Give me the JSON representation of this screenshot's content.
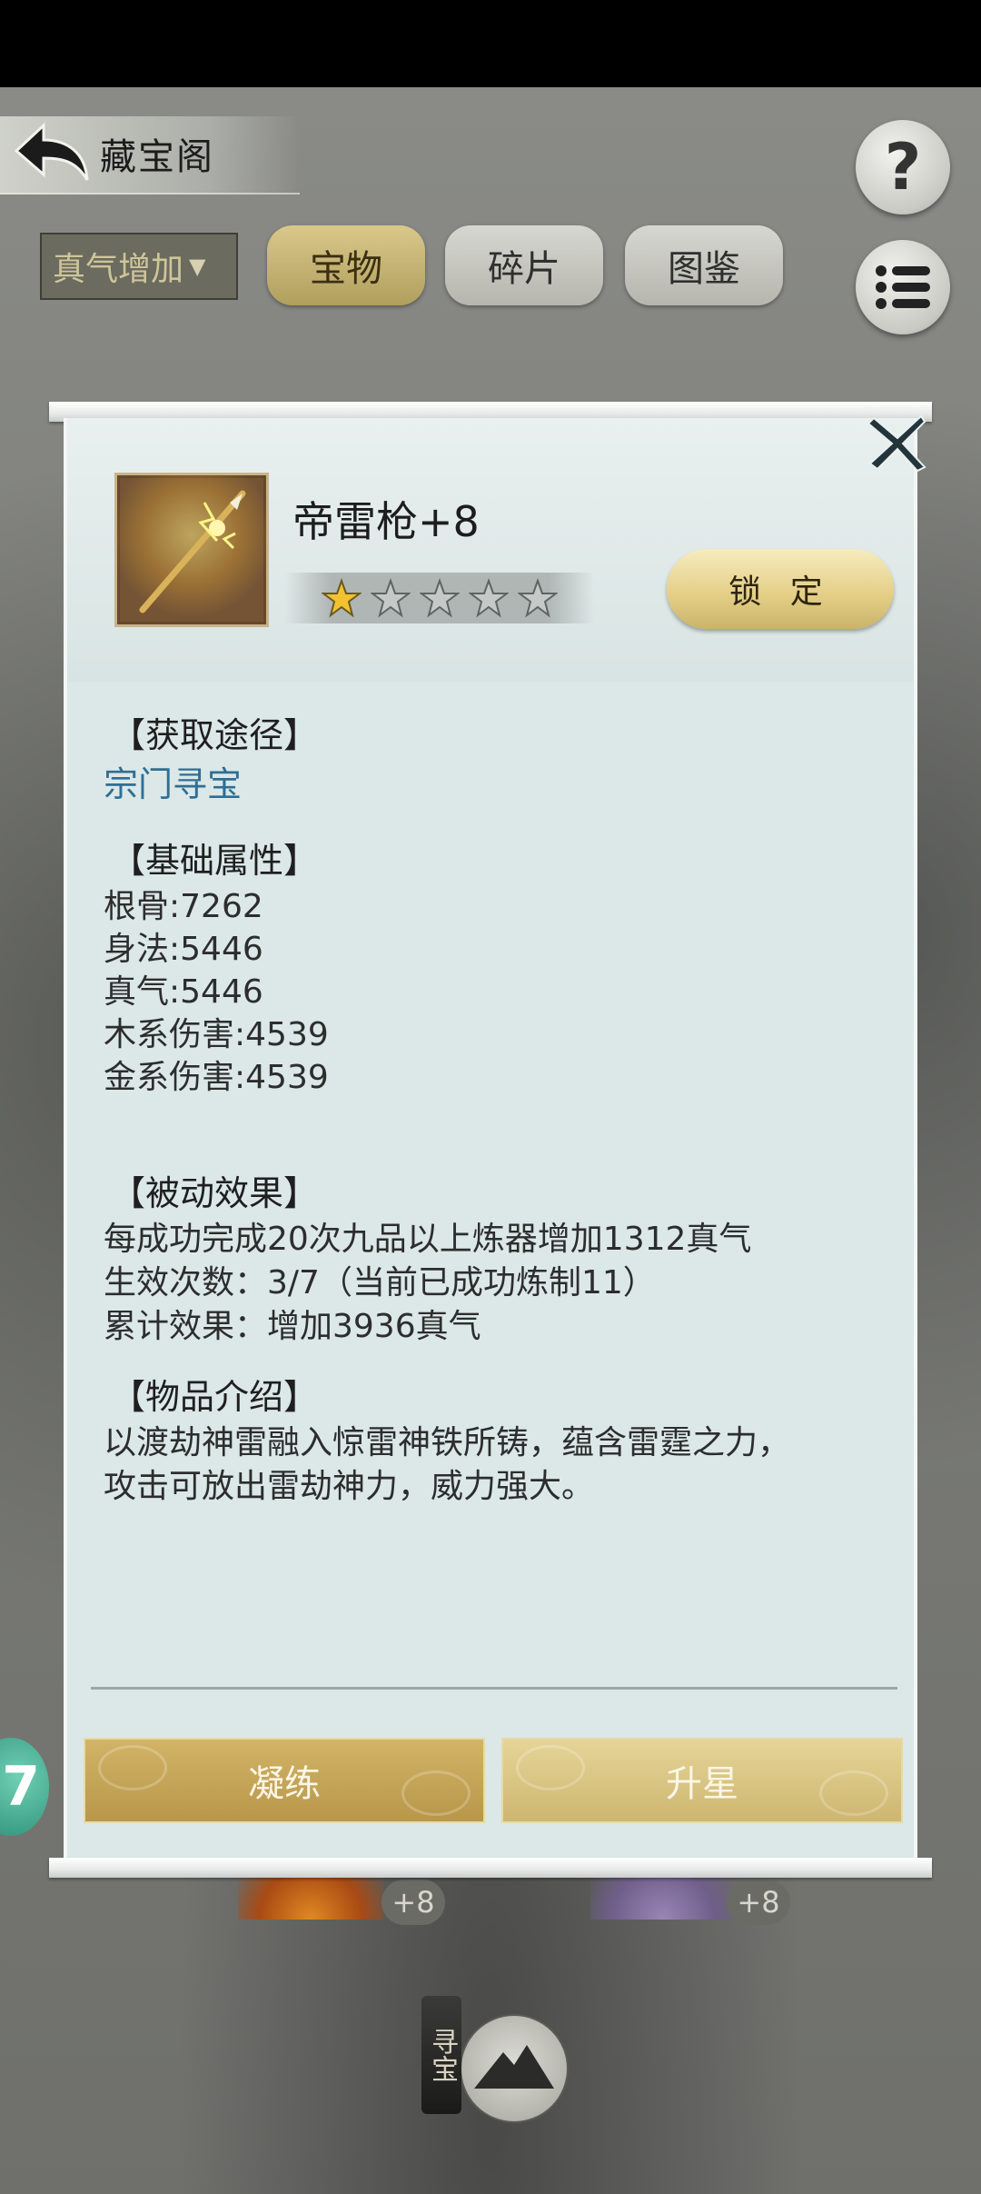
{
  "header": {
    "title": "藏宝阁",
    "help_icon": "question-mark-icon",
    "menu_icon": "list-menu-icon"
  },
  "filter": {
    "selected": "真气增加"
  },
  "tabs": [
    {
      "label": "宝物",
      "active": true
    },
    {
      "label": "碎片",
      "active": false
    },
    {
      "label": "图鉴",
      "active": false
    }
  ],
  "item": {
    "name": "帝雷枪+8",
    "stars_filled": 1,
    "stars_total": 5,
    "lock_label": "锁 定"
  },
  "sections": {
    "acquire_title": "【获取途径】",
    "acquire_link": "宗门寻宝",
    "base_title": "【基础属性】",
    "base_attrs": [
      "根骨:7262",
      "身法:5446",
      "真气:5446",
      "木系伤害:4539",
      "金系伤害:4539"
    ],
    "passive_title": "【被动效果】",
    "passive_lines": [
      "每成功完成20次九品以上炼器增加1312真气",
      "生效次数：3/7（当前已成功炼制11）",
      "累计效果：增加3936真气"
    ],
    "intro_title": "【物品介绍】",
    "intro_lines": [
      "以渡劫神雷融入惊雷神铁所铸，蕴含雷霆之力，",
      "攻击可放出雷劫神力，威力强大。"
    ]
  },
  "actions": {
    "refine_label": "凝练",
    "upstar_label": "升星"
  },
  "background": {
    "badge_left": "+8",
    "badge_right": "+8",
    "side_fab": "7",
    "treasure_label": "寻宝"
  },
  "colors": {
    "gold_button": "#d2b467",
    "panel_bg": "#dbe8e7",
    "link_blue": "#2f6e95"
  }
}
